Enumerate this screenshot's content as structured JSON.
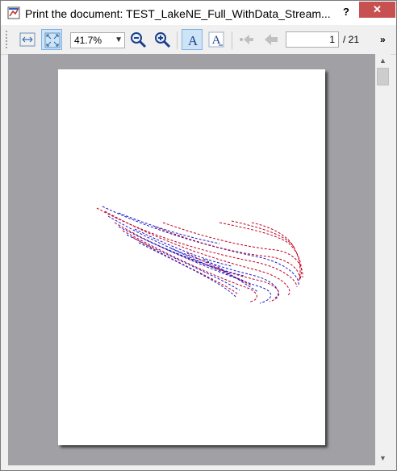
{
  "window": {
    "title": "Print the document: TEST_LakeNE_Full_WithData_Stream...",
    "help_label": "?",
    "close_label": "✕"
  },
  "toolbar": {
    "zoom_value": "41.7%",
    "page_current": "1",
    "page_total": "/ 21",
    "overflow_label": "»"
  },
  "icons": {
    "app": "print-preview-icon",
    "fit_width": "fit-width-icon",
    "fit_page": "fit-page-icon",
    "zoom_out": "zoom-out-icon",
    "zoom_in": "zoom-in-icon",
    "text_mode_a": "text-a-icon",
    "text_mode_b": "text-a-underline-icon",
    "first_page": "first-page-icon",
    "prev_page": "previous-page-icon"
  },
  "colors": {
    "selection_accent": "#7eb4ea",
    "close_button": "#c75050",
    "preview_background": "#a0a0a5",
    "streamline_red": "#c00020",
    "streamline_blue": "#1a1ad0"
  }
}
